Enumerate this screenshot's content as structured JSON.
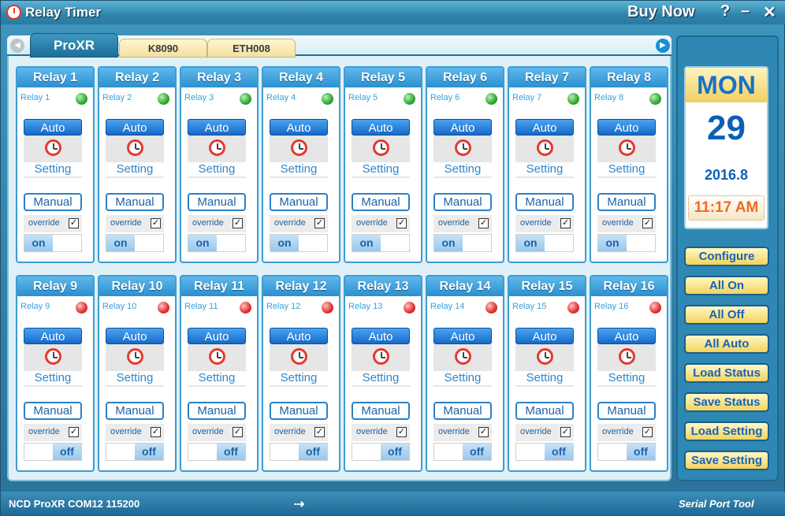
{
  "window": {
    "title": "Relay Timer",
    "buy_now": "Buy Now",
    "help": "?",
    "minimize": "–",
    "close": "✕"
  },
  "tabs": [
    {
      "label": "ProXR",
      "active": true
    },
    {
      "label": "K8090",
      "active": false
    },
    {
      "label": "ETH008",
      "active": false
    }
  ],
  "relays": [
    {
      "title": "Relay 1",
      "sub": "Relay 1",
      "led": "green",
      "state": "on"
    },
    {
      "title": "Relay 2",
      "sub": "Relay 2",
      "led": "green",
      "state": "on"
    },
    {
      "title": "Relay 3",
      "sub": "Relay 3",
      "led": "green",
      "state": "on"
    },
    {
      "title": "Relay 4",
      "sub": "Relay 4",
      "led": "green",
      "state": "on"
    },
    {
      "title": "Relay 5",
      "sub": "Relay 5",
      "led": "green",
      "state": "on"
    },
    {
      "title": "Relay 6",
      "sub": "Relay 6",
      "led": "green",
      "state": "on"
    },
    {
      "title": "Relay 7",
      "sub": "Relay 7",
      "led": "green",
      "state": "on"
    },
    {
      "title": "Relay 8",
      "sub": "Relay 8",
      "led": "green",
      "state": "on"
    },
    {
      "title": "Relay 9",
      "sub": "Relay 9",
      "led": "red",
      "state": "off"
    },
    {
      "title": "Relay 10",
      "sub": "Relay 10",
      "led": "red",
      "state": "off"
    },
    {
      "title": "Relay 11",
      "sub": "Relay 11",
      "led": "red",
      "state": "off"
    },
    {
      "title": "Relay 12",
      "sub": "Relay 12",
      "led": "red",
      "state": "off"
    },
    {
      "title": "Relay 13",
      "sub": "Relay 13",
      "led": "red",
      "state": "off"
    },
    {
      "title": "Relay 14",
      "sub": "Relay 14",
      "led": "red",
      "state": "off"
    },
    {
      "title": "Relay 15",
      "sub": "Relay 15",
      "led": "red",
      "state": "off"
    },
    {
      "title": "Relay 16",
      "sub": "Relay 16",
      "led": "red",
      "state": "off"
    }
  ],
  "relay_labels": {
    "auto": "Auto",
    "setting": "Setting",
    "manual": "Manual",
    "override": "override",
    "override_checked": true,
    "on": "on",
    "off": "off"
  },
  "calendar": {
    "day": "MON",
    "date": "29",
    "year_month": "2016.8",
    "time": "11:17 AM"
  },
  "side_buttons": [
    "Configure",
    "All On",
    "All Off",
    "All Auto",
    "Load Status",
    "Save Status",
    "Load Setting",
    "Save Setting"
  ],
  "statusbar": {
    "text": "NCD ProXR COM12 115200",
    "brand": "Serial Port Tool"
  },
  "colors": {
    "accent": "#2b8fd0",
    "led_on": "#2ea82e",
    "led_off": "#e03030",
    "time": "#f06b22"
  },
  "icons": {
    "app": "alarm-clock-icon",
    "timer": "alarm-clock-icon",
    "status_arrow": "arrow-right-icon"
  }
}
